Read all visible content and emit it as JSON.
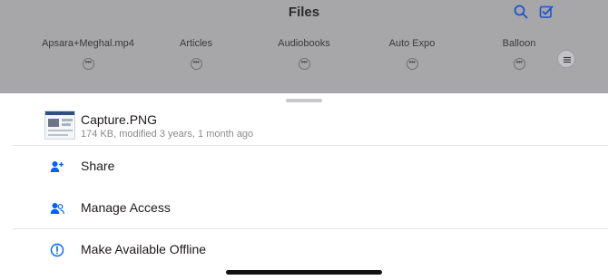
{
  "header": {
    "title": "Files",
    "search_icon": "search-icon",
    "select_icon": "select-checkbox-icon"
  },
  "folders": [
    {
      "name": "Apsara+Meghal.mp4",
      "more": "•••"
    },
    {
      "name": "Articles",
      "more": "•••"
    },
    {
      "name": "Audiobooks",
      "more": "•••"
    },
    {
      "name": "Auto Expo",
      "more": "•••"
    },
    {
      "name": "Balloon",
      "more": "•••"
    }
  ],
  "sheet": {
    "file_name": "Capture.PNG",
    "file_meta": "174 KB, modified 3 years, 1 month ago",
    "actions": [
      {
        "label": "Share",
        "icon": "add-person-icon"
      },
      {
        "label": "Manage Access",
        "icon": "people-icon"
      },
      {
        "label": "Make Available Offline",
        "icon": "offline-icon"
      }
    ]
  },
  "colors": {
    "accent": "#0061fe",
    "overlay": "#a7a7a9",
    "text": "#1e1919",
    "muted": "#8a8a8e"
  }
}
